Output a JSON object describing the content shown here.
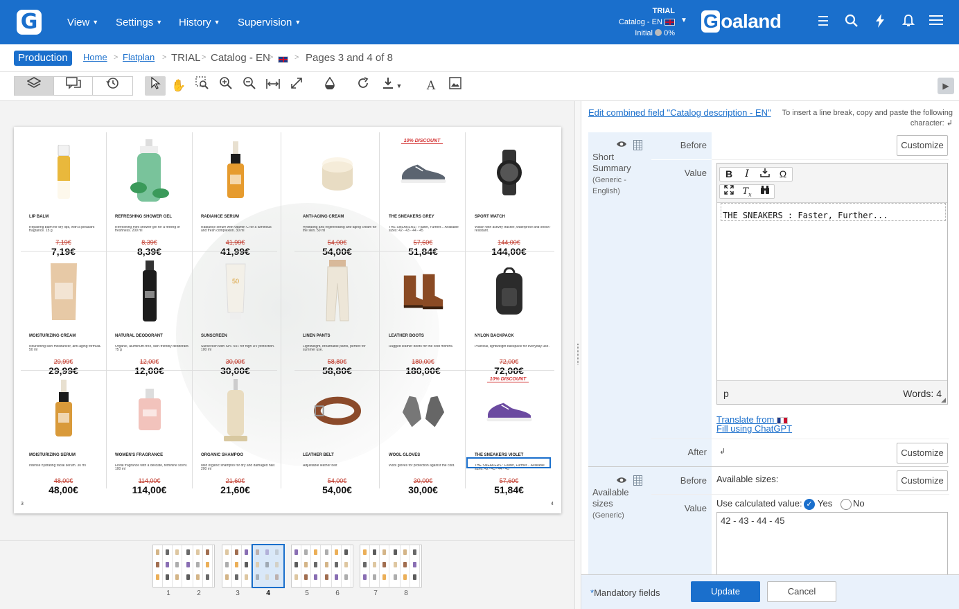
{
  "app": {
    "logo_letter": "G",
    "brand": "Goaland",
    "brand_first": "G",
    "brand_rest": "oaland"
  },
  "menu": [
    {
      "label": "View"
    },
    {
      "label": "Settings"
    },
    {
      "label": "History"
    },
    {
      "label": "Supervision"
    }
  ],
  "status": {
    "trial": "TRIAL",
    "catalog": "Catalog - EN",
    "state": "Initial",
    "progress": "0%"
  },
  "breadcrumb": {
    "badge": "Production",
    "home": "Home",
    "flatplan": "Flatplan",
    "trial": "TRIAL",
    "catalog": "Catalog - EN",
    "pages": "Pages 3 and 4 of 8",
    "sep": ">"
  },
  "spread": {
    "page_left": "3",
    "page_right": "4",
    "products": [
      {
        "name": "LIP BALM",
        "desc": "Repairing balm for dry lips, with a pleasant fragrance. 15 g",
        "old": "7,19€",
        "new": "7,19€",
        "icon": "lip-balm",
        "color": "#e9b83c"
      },
      {
        "name": "REFRESHING SHOWER GEL",
        "desc": "Refreshing mint shower gel for a feeling of freshness. 200 ml",
        "old": "8,39€",
        "new": "8,39€",
        "icon": "shower-gel",
        "color": "#4caf7a"
      },
      {
        "name": "RADIANCE SERUM",
        "desc": "Radiance serum with vitamin C for a luminous and fresh complexion. 30 ml",
        "old": "41,99€",
        "new": "41,99€",
        "icon": "serum",
        "color": "#e69b2e"
      },
      {
        "name": "ANTI-AGING CREAM",
        "desc": "Hydrating and regenerating anti-aging cream for the skin. 50 ml",
        "old": "54,00€",
        "new": "54,00€",
        "icon": "cream-jar",
        "color": "#e8dcc3"
      },
      {
        "name": "THE SNEAKERS GREY",
        "desc": "THE SNEAKERS : Faster, Further... Available sizes: 42 - 43 - 44 - 45",
        "old": "57,60€",
        "new": "51,84€",
        "icon": "sneaker",
        "color": "#5b6470",
        "discount": "10% DISCOUNT"
      },
      {
        "name": "SPORT WATCH",
        "desc": "Watch with activity tracker, waterproof and shock-resistant.",
        "old": "144,00€",
        "new": "144,00€",
        "icon": "watch",
        "color": "#333"
      },
      {
        "name": "MOISTURIZING CREAM",
        "desc": "Nourishing skin moisturizer, anti-aging formula. 50 ml",
        "old": "29,99€",
        "new": "29,99€",
        "icon": "tube",
        "color": "#e7c9a6"
      },
      {
        "name": "NATURAL DEODORANT",
        "desc": "Organic, aluminum-free, skin-friendly deodorant. 75 g",
        "old": "12,00€",
        "new": "12,00€",
        "icon": "deodorant",
        "color": "#1c1c1c"
      },
      {
        "name": "SUNSCREEN",
        "desc": "Sunscreen with SPF 50+ for high UV protection. 100 ml",
        "old": "30,00€",
        "new": "30,00€",
        "icon": "sunscreen",
        "color": "#f3f0e8"
      },
      {
        "name": "LINEN PANTS",
        "desc": "Lightweight, breathable pants, perfect for summer use.",
        "old": "58,80€",
        "new": "58,80€",
        "icon": "pants",
        "color": "#ede6d8"
      },
      {
        "name": "LEATHER BOOTS",
        "desc": "Rugged leather boots for the cold months.",
        "old": "180,00€",
        "new": "180,00€",
        "icon": "boots",
        "color": "#8a4a24"
      },
      {
        "name": "NYLON BACKPACK",
        "desc": "Practical, lightweight backpack for everyday use.",
        "old": "72,00€",
        "new": "72,00€",
        "icon": "backpack",
        "color": "#2b2b2b"
      },
      {
        "name": "MOISTURIZING SERUM",
        "desc": "Intense hydrating facial serum. 30 ml",
        "old": "48,00€",
        "new": "48,00€",
        "icon": "serum",
        "color": "#d99a3a"
      },
      {
        "name": "WOMEN'S FRAGRANCE",
        "desc": "Floral fragrance with a delicate, feminine scent. 100 ml",
        "old": "114,00€",
        "new": "114,00€",
        "icon": "perfume",
        "color": "#f0b9b0"
      },
      {
        "name": "ORGANIC SHAMPOO",
        "desc": "Mild organic shampoo for dry and damaged hair. 200 ml",
        "old": "21,60€",
        "new": "21,60€",
        "icon": "shampoo",
        "color": "#e9dcc0"
      },
      {
        "name": "LEATHER BELT",
        "desc": "Adjustable leather belt",
        "old": "54,00€",
        "new": "54,00€",
        "icon": "belt",
        "color": "#8b4a2a"
      },
      {
        "name": "WOOL GLOVES",
        "desc": "Wool gloves for protection against the cold.",
        "old": "30,00€",
        "new": "30,00€",
        "icon": "gloves",
        "color": "#777"
      },
      {
        "name": "THE SNEAKERS VIOLET",
        "desc": "THE SNEAKERS : Faster, Further... Available sizes: 42 - 43 - 44 - 45",
        "old": "57,60€",
        "new": "51,84€",
        "icon": "sneaker",
        "color": "#6b4aa0",
        "discount": "10% DISCOUNT"
      }
    ]
  },
  "thumbnails": [
    {
      "num": "1"
    },
    {
      "num": "2"
    },
    {
      "num": "3"
    },
    {
      "num": "4"
    },
    {
      "num": "5"
    },
    {
      "num": "6"
    },
    {
      "num": "7"
    },
    {
      "num": "8"
    }
  ],
  "panel": {
    "edit_link": "Edit combined field \"Catalog description - EN\"",
    "hint": "To insert a line break, copy and paste the following character: ↲",
    "field1": {
      "name": "Short Summary",
      "generic": "(Generic - English)",
      "before_label": "Before",
      "value_label": "Value",
      "after_label": "After",
      "customize": "Customize",
      "content": "THE SNEAKERS : Faster, Further...",
      "status_tag": "p",
      "words": "Words: 4",
      "translate": "Translate from",
      "chatgpt": "Fill using ChatGPT",
      "after_value": "↲"
    },
    "field2": {
      "name": "Available sizes",
      "generic": "(Generic)",
      "before_label": "Before",
      "value_label": "Value",
      "customize": "Customize",
      "before_value": "Available sizes:",
      "calc_label": "Use calculated value:",
      "yes": "Yes",
      "no": "No",
      "value": "42 - 43 - 44 - 45"
    }
  },
  "footer": {
    "mandatory": "Mandatory fields",
    "update": "Update",
    "cancel": "Cancel"
  }
}
